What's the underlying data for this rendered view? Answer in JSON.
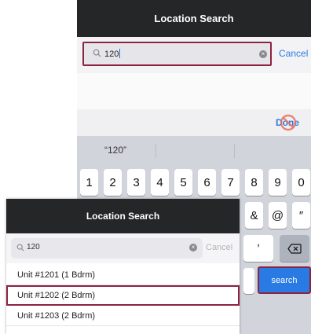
{
  "back_screen": {
    "title": "Location Search",
    "search_value": "120",
    "cancel_label": "Cancel",
    "done_label": "Done",
    "suggestion": "“120”",
    "keyboard": {
      "row1": [
        "1",
        "2",
        "3",
        "4",
        "5",
        "6",
        "7",
        "8",
        "9",
        "0"
      ],
      "row2_visible": [
        "&",
        "@",
        "″"
      ],
      "row3_visible": [
        "’"
      ],
      "backspace_icon": "backspace-icon",
      "search_key": "search"
    },
    "highlight_color": "#8b2440",
    "accent_color": "#2a7ae4"
  },
  "front_screen": {
    "title": "Location Search",
    "search_value": "120",
    "cancel_label": "Cancel",
    "results": [
      {
        "label": "Unit #1201 (1 Bdrm)"
      },
      {
        "label": "Unit #1202 (2 Bdrm)"
      },
      {
        "label": "Unit #1203 (2 Bdrm)"
      }
    ],
    "selected_index": 1
  }
}
